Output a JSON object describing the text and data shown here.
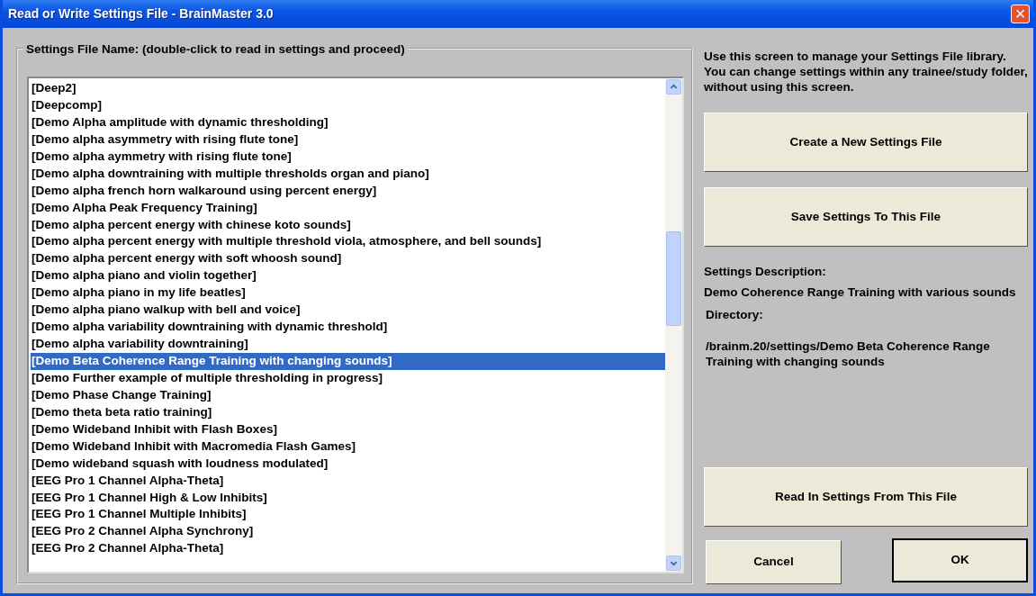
{
  "window": {
    "title": "Read or Write Settings File - BrainMaster 3.0",
    "close": "×"
  },
  "file_list": {
    "legend": "Settings File Name: (double-click to read in settings and proceed)",
    "items": [
      {
        "label": "[Deep2]",
        "selected": false
      },
      {
        "label": "[Deepcomp]",
        "selected": false
      },
      {
        "label": "[Demo Alpha amplitude with dynamic thresholding]",
        "selected": false
      },
      {
        "label": "[Demo alpha asymmetry with rising flute tone]",
        "selected": false
      },
      {
        "label": "[Demo alpha aymmetry with rising flute tone]",
        "selected": false
      },
      {
        "label": "[Demo alpha downtraining with multiple thresholds organ and piano]",
        "selected": false
      },
      {
        "label": "[Demo alpha french horn walkaround using percent energy]",
        "selected": false
      },
      {
        "label": "[Demo Alpha Peak Frequency Training]",
        "selected": false
      },
      {
        "label": "[Demo alpha percent energy with chinese koto sounds]",
        "selected": false
      },
      {
        "label": "[Demo alpha percent energy with multiple threshold viola, atmosphere, and bell sounds]",
        "selected": false
      },
      {
        "label": "[Demo alpha percent energy with soft whoosh sound]",
        "selected": false
      },
      {
        "label": "[Demo alpha piano and violin together]",
        "selected": false
      },
      {
        "label": "[Demo alpha piano in my life beatles]",
        "selected": false
      },
      {
        "label": "[Demo alpha piano walkup with bell and voice]",
        "selected": false
      },
      {
        "label": "[Demo alpha variability downtraining with dynamic threshold]",
        "selected": false
      },
      {
        "label": "[Demo alpha variability downtraining]",
        "selected": false
      },
      {
        "label": "[Demo Beta Coherence Range Training with changing sounds]",
        "selected": true
      },
      {
        "label": "[Demo Further example of multiple thresholding in progress]",
        "selected": false
      },
      {
        "label": "[Demo Phase Change Training]",
        "selected": false
      },
      {
        "label": "[Demo theta beta ratio training]",
        "selected": false
      },
      {
        "label": "[Demo Wideband Inhibit with Flash Boxes]",
        "selected": false
      },
      {
        "label": "[Demo Wideband Inhibit with Macromedia Flash Games]",
        "selected": false
      },
      {
        "label": "[Demo wideband squash with loudness modulated]",
        "selected": false
      },
      {
        "label": "[EEG Pro 1 Channel Alpha-Theta]",
        "selected": false
      },
      {
        "label": "[EEG Pro 1 Channel High & Low Inhibits]",
        "selected": false
      },
      {
        "label": "[EEG Pro 1 Channel Multiple Inhibits]",
        "selected": false
      },
      {
        "label": "[EEG Pro 2 Channel Alpha Synchrony]",
        "selected": false
      },
      {
        "label": "[EEG Pro 2 Channel Alpha-Theta]",
        "selected": false
      }
    ]
  },
  "help_text": "Use this screen to manage your Settings File library.  You can change settings within any trainee/study folder, without using this screen.",
  "create_button": "Create a New Settings File",
  "save_button": "Save Settings To This File",
  "description_label": "Settings Description:",
  "description": "Demo Coherence Range Training with various sounds",
  "directory_label": "Directory:",
  "directory": "/brainm.20/settings/Demo Beta Coherence Range Training with changing sounds",
  "read_button": "Read In Settings From This File",
  "cancel_button": "Cancel",
  "ok_button": "OK"
}
